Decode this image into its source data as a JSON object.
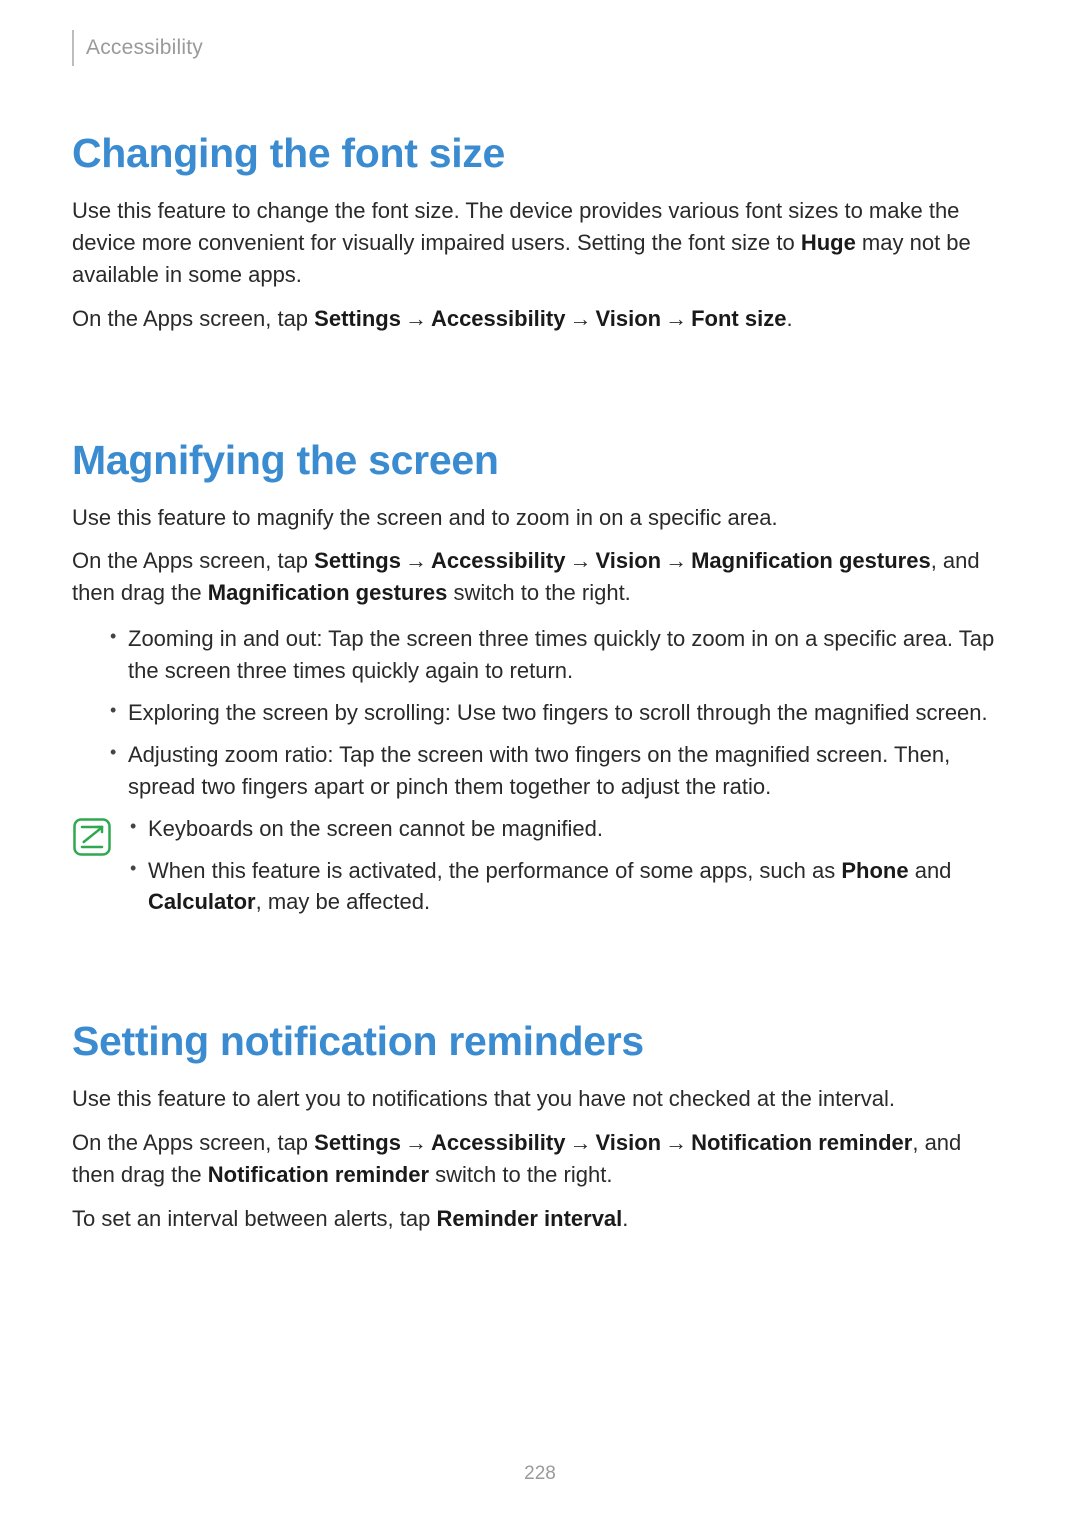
{
  "breadcrumb": "Accessibility",
  "page_number": "228",
  "arrow": "→",
  "s1": {
    "title": "Changing the font size",
    "p1a": "Use this feature to change the font size. The device provides various font sizes to make the device more convenient for visually impaired users. Setting the font size to ",
    "p1b": "Huge",
    "p1c": " may not be available in some apps.",
    "p2a": "On the Apps screen, tap ",
    "nav1": "Settings",
    "nav2": "Accessibility",
    "nav3": "Vision",
    "nav4": "Font size",
    "p2b": "."
  },
  "s2": {
    "title": "Magnifying the screen",
    "p1": "Use this feature to magnify the screen and to zoom in on a specific area.",
    "p2a": "On the Apps screen, tap ",
    "nav1": "Settings",
    "nav2": "Accessibility",
    "nav3": "Vision",
    "nav4": "Magnification gestures",
    "p2b": ", and then drag the ",
    "p2c": "Magnification gestures",
    "p2d": " switch to the right.",
    "b1": "Zooming in and out: Tap the screen three times quickly to zoom in on a specific area. Tap the screen three times quickly again to return.",
    "b2": "Exploring the screen by scrolling: Use two fingers to scroll through the magnified screen.",
    "b3": "Adjusting zoom ratio: Tap the screen with two fingers on the magnified screen. Then, spread two fingers apart or pinch them together to adjust the ratio.",
    "n1": "Keyboards on the screen cannot be magnified.",
    "n2a": "When this feature is activated, the performance of some apps, such as ",
    "n2b": "Phone",
    "n2c": " and ",
    "n2d": "Calculator",
    "n2e": ", may be affected."
  },
  "s3": {
    "title": "Setting notification reminders",
    "p1": "Use this feature to alert you to notifications that you have not checked at the interval.",
    "p2a": "On the Apps screen, tap ",
    "nav1": "Settings",
    "nav2": "Accessibility",
    "nav3": "Vision",
    "nav4": "Notification reminder",
    "p2b": ", and then drag the ",
    "p2c": "Notification reminder",
    "p2d": " switch to the right.",
    "p3a": "To set an interval between alerts, tap ",
    "p3b": "Reminder interval",
    "p3c": "."
  }
}
